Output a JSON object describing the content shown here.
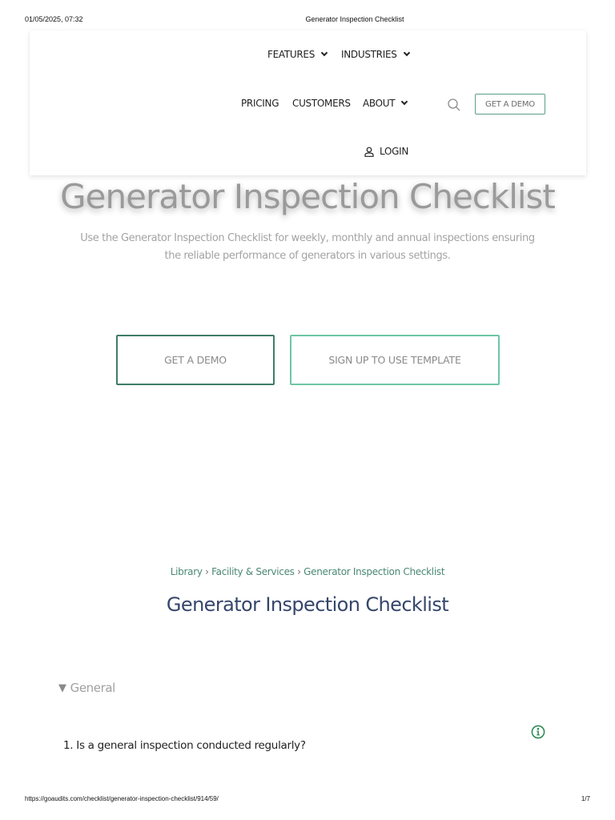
{
  "print_header": {
    "datetime": "01/05/2025, 07:32",
    "title": "Generator Inspection Checklist"
  },
  "print_footer": {
    "url": "https://goaudits.com/checklist/generator-inspection-checklist/914/59/",
    "page": "1/7"
  },
  "nav": {
    "features": "FEATURES",
    "industries": "INDUSTRIES",
    "pricing": "PRICING",
    "customers": "CUSTOMERS",
    "about": "ABOUT",
    "get_demo": "GET A DEMO",
    "login": "LOGIN",
    "icons": [
      "chevron-down-icon",
      "search-icon",
      "user-icon"
    ]
  },
  "hero": {
    "title": "Generator Inspection Checklist",
    "subtitle": "Use the Generator Inspection Checklist for weekly, monthly and annual inspections ensuring the reliable performance of generators in various settings.",
    "demo_button": "GET A DEMO",
    "signup_button": "SIGN UP TO USE TEMPLATE"
  },
  "breadcrumb": {
    "items": [
      "Library",
      "Facility & Services",
      "Generator Inspection Checklist"
    ],
    "separator": "›"
  },
  "checklist": {
    "title": "Generator Inspection Checklist",
    "section": "General",
    "questions": [
      "1. Is a general inspection conducted regularly?"
    ]
  },
  "colors": {
    "accent_dark": "#3f7d65",
    "accent_light": "#6ec6a4",
    "title_navy": "#36466b",
    "info_green": "#2e8b57"
  }
}
